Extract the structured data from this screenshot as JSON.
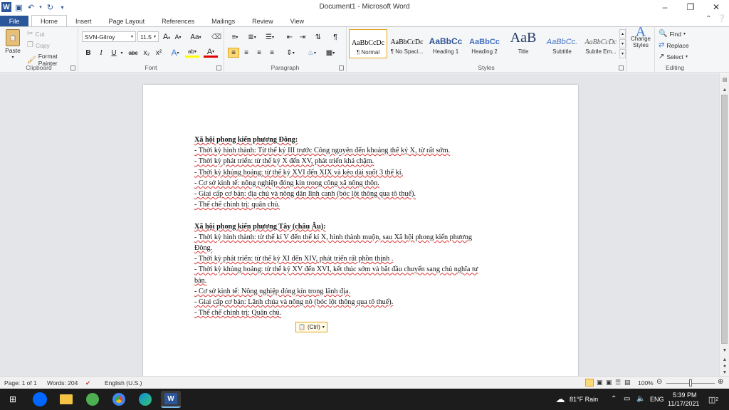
{
  "window": {
    "title": "Document1 - Microsoft Word"
  },
  "quick_access": {
    "logo": "W"
  },
  "tabs": [
    "File",
    "Home",
    "Insert",
    "Page Layout",
    "References",
    "Mailings",
    "Review",
    "View"
  ],
  "clipboard": {
    "paste": "Paste",
    "cut": "Cut",
    "copy": "Copy",
    "format_painter": "Format Painter",
    "label": "Clipboard"
  },
  "font": {
    "name": "SVN-Gilroy",
    "size": "11.5",
    "label": "Font",
    "grow": "A",
    "shrink": "A",
    "case": "Aa",
    "bold": "B",
    "italic": "I",
    "underline": "U",
    "strike": "abc",
    "sub": "x₂",
    "sup": "x²",
    "effects": "A",
    "highlight": "ab",
    "color": "A"
  },
  "paragraph": {
    "label": "Paragraph"
  },
  "styles": {
    "label": "Styles",
    "items": [
      {
        "preview": "AaBbCcDc",
        "name": "¶ Normal"
      },
      {
        "preview": "AaBbCcDc",
        "name": "¶ No Spaci..."
      },
      {
        "preview": "AaBbCc",
        "name": "Heading 1"
      },
      {
        "preview": "AaBbCc",
        "name": "Heading 2"
      },
      {
        "preview": "AaB",
        "name": "Title"
      },
      {
        "preview": "AaBbCc.",
        "name": "Subtitle"
      },
      {
        "preview": "AaBbCcDc",
        "name": "Subtle Em..."
      }
    ],
    "change_styles": "Change Styles",
    "change_preview": "A"
  },
  "editing": {
    "label": "Editing",
    "find": "Find",
    "replace": "Replace",
    "select": "Select"
  },
  "document": {
    "lines": [
      {
        "text": "Xã hội phong kiến phương Đông:",
        "heading": true
      },
      {
        "text": "- Thời kỳ hình thành: Từ thế kỷ III trước Công nguyên đến khoảng thế kỷ X, từ rất sớm."
      },
      {
        "text": "- Thời kỳ phát triển: từ thế kỷ X đến XV, phát triển khá chậm."
      },
      {
        "text": "- Thời kỳ khủng hoảng: từ thế kỷ XVI đến XIX và kéo dài suốt 3 thế kỉ."
      },
      {
        "text": "- Cơ sở kinh tế: nông nghiệp đóng kín trong công xã nông thôn."
      },
      {
        "text": "- Giai cấp cơ bản: địa chủ và nông dân lĩnh canh (bóc lột thông qua tô thuế)."
      },
      {
        "text": "- Thể chế chính trị: quân chủ."
      },
      {
        "text": "",
        "blank": true
      },
      {
        "text": "Xã hội phong kiến phương Tây (châu Âu):",
        "heading": true
      },
      {
        "text": "- Thời kỳ hình thành: từ thế kỉ V đến thế kỉ X, hình thành muộn, sau Xã hội phong kiến phương"
      },
      {
        "text": "Đông."
      },
      {
        "text": "- Thời kỳ phát triển: từ thế kỷ XI đến XIV, phát triển rất phồn thịnh ."
      },
      {
        "text": "- Thời kỳ khủng hoảng: từ thế kỷ XV đến XVI, kết thúc sớm và bắt đầu chuyển sang chủ nghĩa tư"
      },
      {
        "text": "bản."
      },
      {
        "text": "- Cơ sở kinh tế: Nông nghiệp đóng kín  trong lãnh địa."
      },
      {
        "text": "- Giai cấp cơ bản: Lãnh chúa và nông nô (bóc lột thông qua tô thuế)."
      },
      {
        "text": "- Thể chế chính trị: Quân chủ."
      }
    ],
    "paste_options": "(Ctrl)"
  },
  "status": {
    "page": "Page: 1 of 1",
    "words": "Words: 204",
    "language": "English (U.S.)",
    "zoom": "100%"
  },
  "taskbar": {
    "weather": "81°F  Rain",
    "lang": "ENG",
    "time": "5:39 PM",
    "date": "11/17/2021",
    "notifications": "2"
  },
  "colors": {
    "accent": "#2b579a",
    "highlight": "#fbd978",
    "page_bg": "#e3e5e8"
  }
}
